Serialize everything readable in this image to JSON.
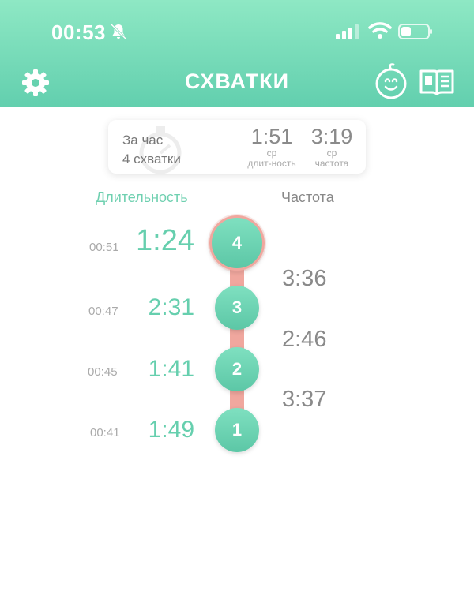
{
  "status_bar": {
    "time": "00:53",
    "icons": [
      "bell-slash-icon",
      "cellular-signal-icon",
      "wifi-icon",
      "battery-icon"
    ]
  },
  "header": {
    "title": "СХВАТКИ",
    "left_icon": "gear-icon",
    "right_icons": [
      "baby-face-icon",
      "book-icon"
    ],
    "background": "#6fd9b6"
  },
  "summary": {
    "period_label": "За час",
    "count_label": "4 схватки",
    "avg_duration": {
      "value": "1:51",
      "sub1": "ср",
      "sub2": "длит-ность"
    },
    "avg_frequency": {
      "value": "3:19",
      "sub1": "ср",
      "sub2": "частота"
    }
  },
  "columns": {
    "duration": "Длительность",
    "frequency": "Частота"
  },
  "contractions": [
    {
      "number": "4",
      "time": "00:51",
      "duration": "1:24",
      "latest": true
    },
    {
      "number": "3",
      "time": "00:47",
      "duration": "2:31"
    },
    {
      "number": "2",
      "time": "00:45",
      "duration": "1:41"
    },
    {
      "number": "1",
      "time": "00:41",
      "duration": "1:49"
    }
  ],
  "intervals": [
    "3:36",
    "2:46",
    "3:37"
  ],
  "colors": {
    "accent_green": "#66cfae",
    "connector_pink": "#f0a79e",
    "text_gray": "#8a8a8a"
  }
}
